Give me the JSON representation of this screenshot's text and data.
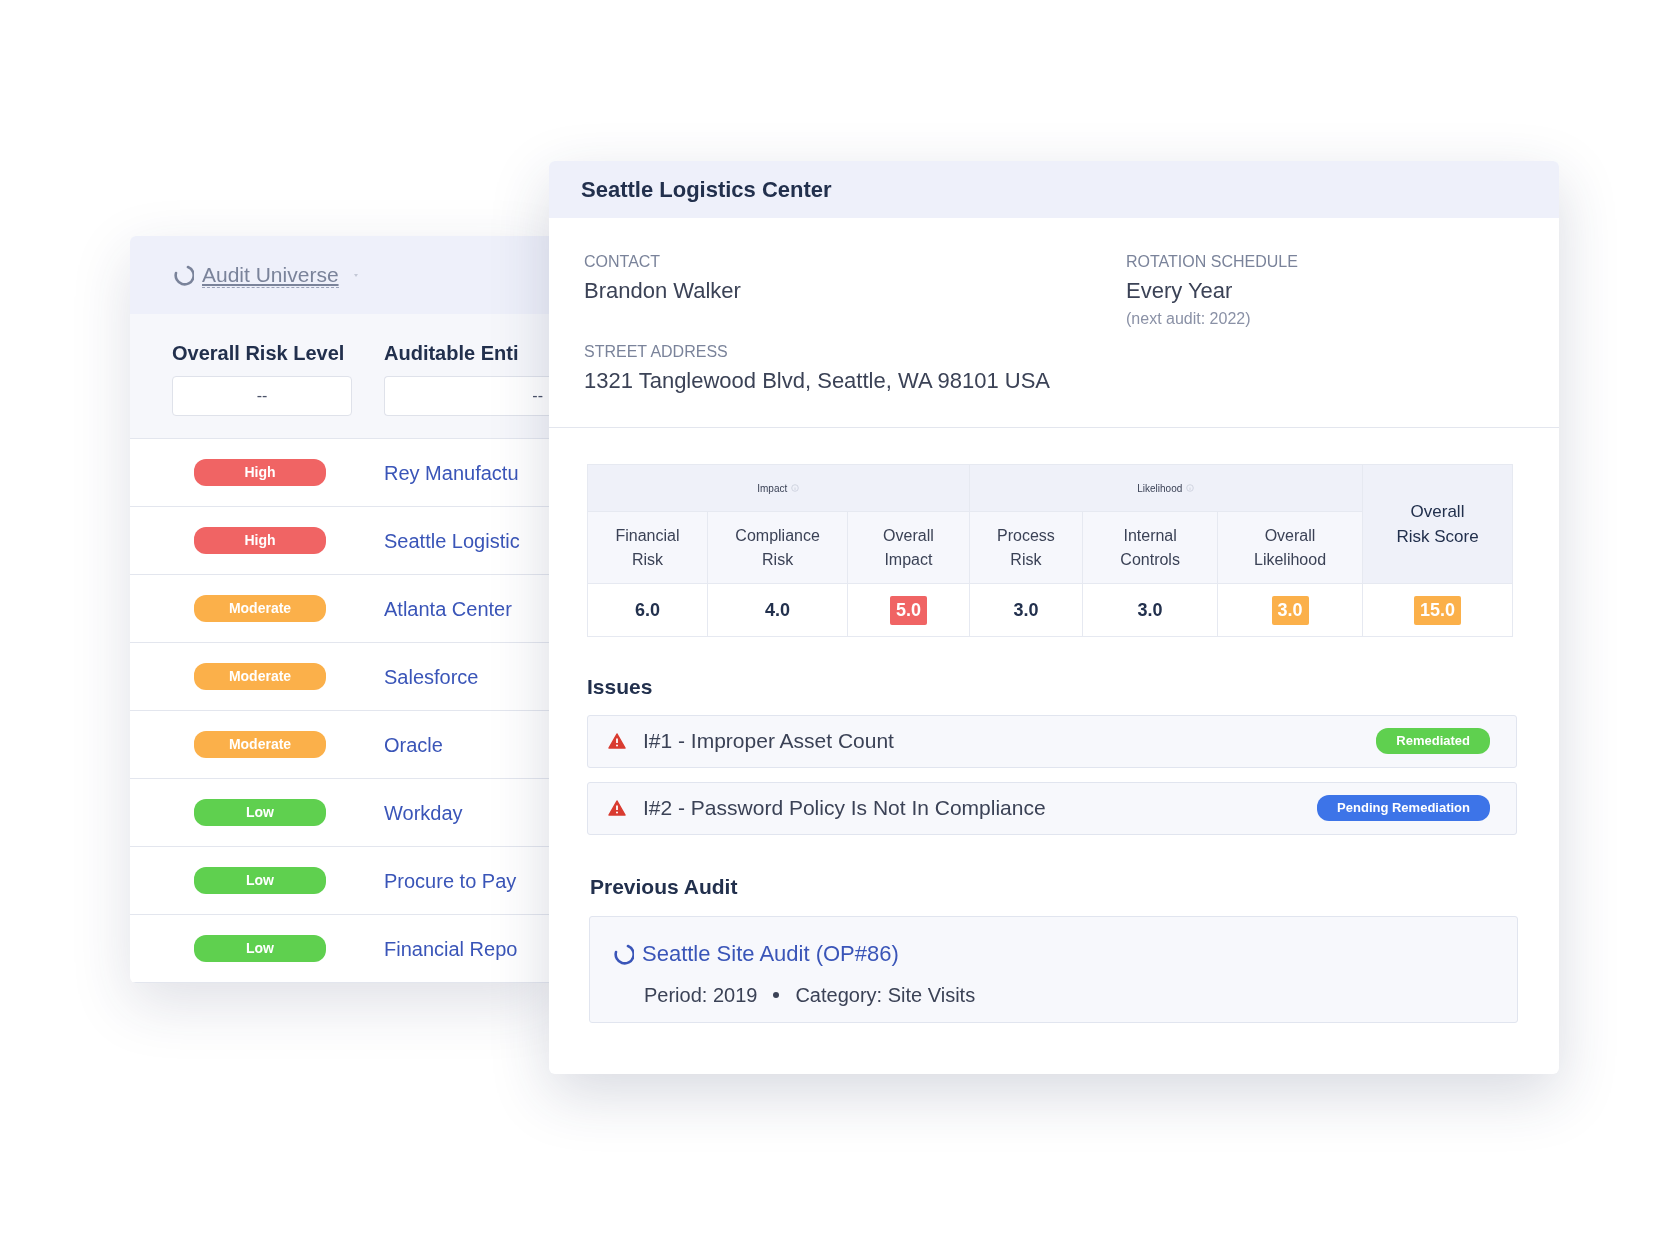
{
  "list_panel": {
    "title": "Audit Universe",
    "columns": [
      {
        "label": "Overall Risk Level",
        "filter": "--"
      },
      {
        "label": "Auditable Enti",
        "filter": "--"
      }
    ],
    "rows": [
      {
        "risk": "High",
        "color": "#f06464",
        "entity": "Rey Manufactu"
      },
      {
        "risk": "High",
        "color": "#f06464",
        "entity": "Seattle Logistic"
      },
      {
        "risk": "Moderate",
        "color": "#fbb04a",
        "entity": "Atlanta Center"
      },
      {
        "risk": "Moderate",
        "color": "#fbb04a",
        "entity": "Salesforce"
      },
      {
        "risk": "Moderate",
        "color": "#fbb04a",
        "entity": "Oracle"
      },
      {
        "risk": "Low",
        "color": "#5fd04f",
        "entity": "Workday"
      },
      {
        "risk": "Low",
        "color": "#5fd04f",
        "entity": "Procure to Pay"
      },
      {
        "risk": "Low",
        "color": "#5fd04f",
        "entity": "Financial Repo"
      }
    ]
  },
  "detail": {
    "title": "Seattle Logistics Center",
    "contact": {
      "label": "CONTACT",
      "value": "Brandon Walker"
    },
    "rotation": {
      "label": "ROTATION SCHEDULE",
      "value": "Every Year",
      "note": "(next audit: 2022)"
    },
    "address": {
      "label": "STREET ADDRESS",
      "value": "1321 Tanglewood Blvd, Seattle, WA 98101 USA"
    },
    "risk_table": {
      "groups": [
        {
          "label": "Impact",
          "columns": [
            {
              "label": "Financial Risk",
              "value": "6.0"
            },
            {
              "label": "Compliance Risk",
              "value": "4.0"
            },
            {
              "label": "Overall Impact",
              "value": "5.0",
              "color": "#f06464"
            }
          ]
        },
        {
          "label": "Likelihood",
          "columns": [
            {
              "label": "Process Risk",
              "value": "3.0"
            },
            {
              "label": "Internal Controls",
              "value": "3.0"
            },
            {
              "label": "Overall Likelihood",
              "value": "3.0",
              "color": "#fbb04a"
            }
          ]
        }
      ],
      "total": {
        "label": "Overall Risk Score",
        "value": "15.0",
        "color": "#fbb04a"
      }
    },
    "issues_heading": "Issues",
    "issues": [
      {
        "title": "I#1 - Improper Asset Count",
        "status": "Remediated",
        "color": "#5fd04f"
      },
      {
        "title": "I#2 - Password Policy Is Not In Compliance",
        "status": "Pending Remediation",
        "color": "#3d74e8"
      }
    ],
    "previous_heading": "Previous Audit",
    "previous_audit": {
      "link": "Seattle Site Audit (OP#86)",
      "period": "Period: 2019",
      "category": "Category: Site Visits"
    }
  }
}
